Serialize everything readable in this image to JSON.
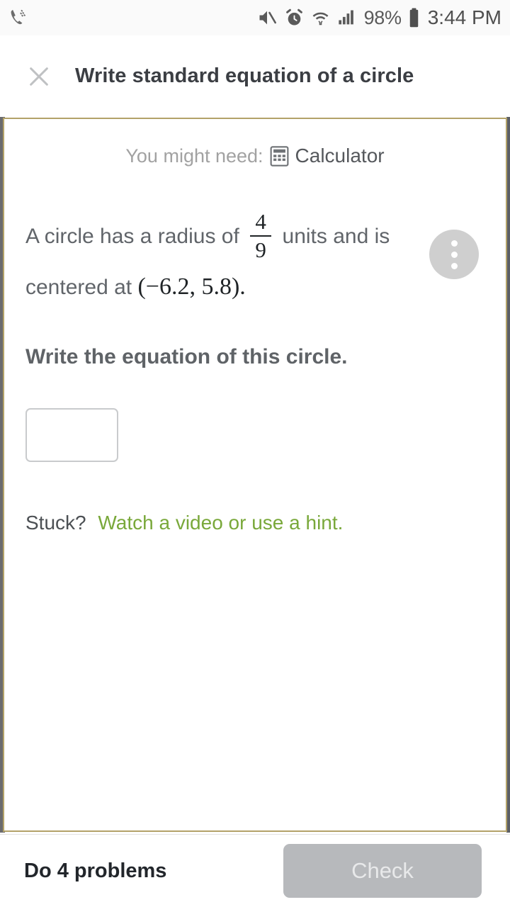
{
  "statusbar": {
    "icons": [
      "vibrate-call-icon",
      "mute-icon",
      "alarm-icon",
      "wifi-icon",
      "signal-icon",
      "battery-icon"
    ],
    "battery_percent": "98%",
    "clock": "3:44 PM"
  },
  "header": {
    "close_icon": "close-icon",
    "title": "Write standard equation of a circle"
  },
  "card": {
    "need": {
      "label": "You might need:",
      "icon": "calculator-icon",
      "link": "Calculator"
    },
    "menu_button": "overflow-menu-icon",
    "problem": {
      "text_before_fraction": "A circle has a radius of",
      "fraction_numerator": "4",
      "fraction_denominator": "9",
      "text_after_fraction": "units and is",
      "text_line2_prefix": "centered at",
      "coordinates": "(−6.2, 5.8).",
      "instruction": "Write the equation of this circle."
    },
    "answer": {
      "value": "",
      "placeholder": ""
    },
    "stuck": {
      "label": "Stuck?",
      "link": "Watch a video or use a hint."
    }
  },
  "bottombar": {
    "problems_count": "Do 4 problems",
    "check_label": "Check"
  },
  "colors": {
    "card_border": "#b3a269",
    "link_green": "#79a83a",
    "check_disabled": "#b7b9bc"
  }
}
